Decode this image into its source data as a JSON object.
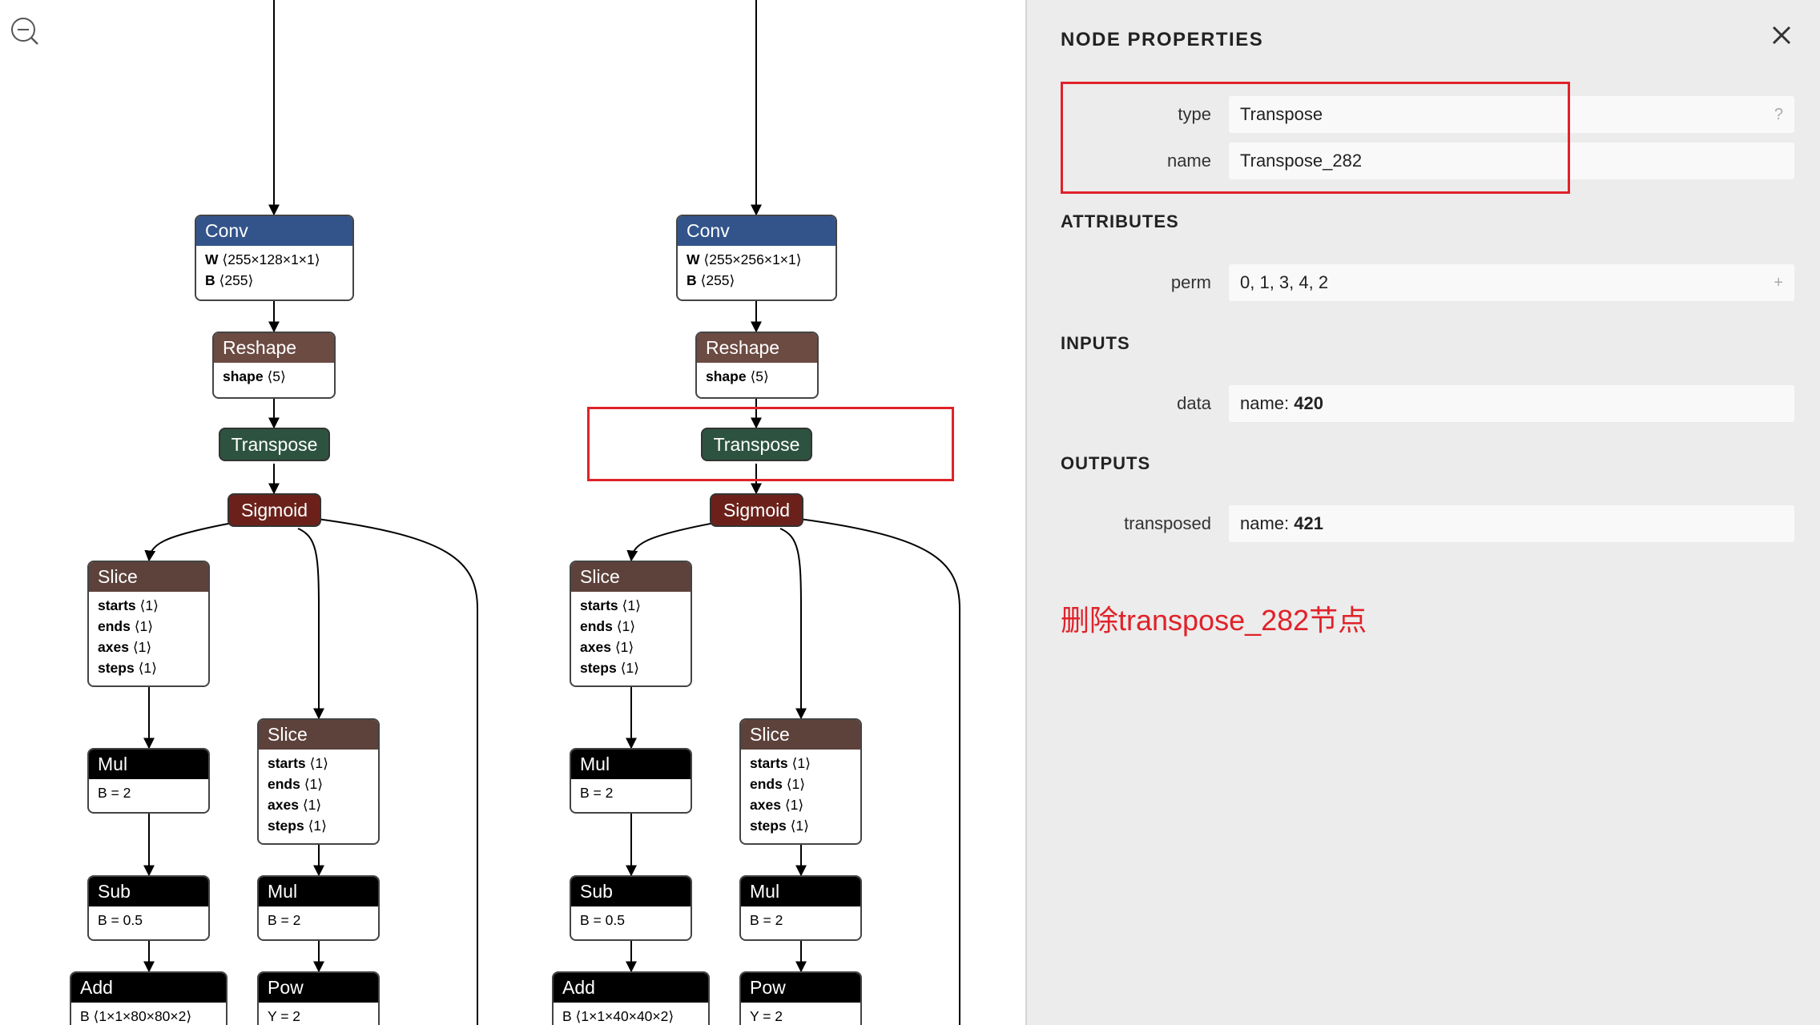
{
  "graph": {
    "left": {
      "conv": {
        "op": "Conv",
        "attrs": [
          {
            "k": "W",
            "v": "⟨255×128×1×1⟩"
          },
          {
            "k": "B",
            "v": "⟨255⟩"
          }
        ]
      },
      "reshape": {
        "op": "Reshape",
        "attrs": [
          {
            "k": "shape",
            "v": "⟨5⟩"
          }
        ]
      },
      "transpose": {
        "op": "Transpose"
      },
      "sigmoid": {
        "op": "Sigmoid"
      },
      "slice1": {
        "op": "Slice",
        "attrs": [
          {
            "k": "starts",
            "v": "⟨1⟩"
          },
          {
            "k": "ends",
            "v": "⟨1⟩"
          },
          {
            "k": "axes",
            "v": "⟨1⟩"
          },
          {
            "k": "steps",
            "v": "⟨1⟩"
          }
        ]
      },
      "slice2": {
        "op": "Slice",
        "attrs": [
          {
            "k": "starts",
            "v": "⟨1⟩"
          },
          {
            "k": "ends",
            "v": "⟨1⟩"
          },
          {
            "k": "axes",
            "v": "⟨1⟩"
          },
          {
            "k": "steps",
            "v": "⟨1⟩"
          }
        ]
      },
      "mul1": {
        "op": "Mul",
        "text": "B = 2"
      },
      "mul2": {
        "op": "Mul",
        "text": "B = 2"
      },
      "sub": {
        "op": "Sub",
        "text": "B = 0.5"
      },
      "add": {
        "op": "Add",
        "text": "B ⟨1×1×80×80×2⟩"
      },
      "pow": {
        "op": "Pow",
        "text": "Y = 2"
      }
    },
    "right": {
      "conv": {
        "op": "Conv",
        "attrs": [
          {
            "k": "W",
            "v": "⟨255×256×1×1⟩"
          },
          {
            "k": "B",
            "v": "⟨255⟩"
          }
        ]
      },
      "reshape": {
        "op": "Reshape",
        "attrs": [
          {
            "k": "shape",
            "v": "⟨5⟩"
          }
        ]
      },
      "transpose": {
        "op": "Transpose"
      },
      "sigmoid": {
        "op": "Sigmoid"
      },
      "slice1": {
        "op": "Slice",
        "attrs": [
          {
            "k": "starts",
            "v": "⟨1⟩"
          },
          {
            "k": "ends",
            "v": "⟨1⟩"
          },
          {
            "k": "axes",
            "v": "⟨1⟩"
          },
          {
            "k": "steps",
            "v": "⟨1⟩"
          }
        ]
      },
      "slice2": {
        "op": "Slice",
        "attrs": [
          {
            "k": "starts",
            "v": "⟨1⟩"
          },
          {
            "k": "ends",
            "v": "⟨1⟩"
          },
          {
            "k": "axes",
            "v": "⟨1⟩"
          },
          {
            "k": "steps",
            "v": "⟨1⟩"
          }
        ]
      },
      "mul1": {
        "op": "Mul",
        "text": "B = 2"
      },
      "mul2": {
        "op": "Mul",
        "text": "B = 2"
      },
      "sub": {
        "op": "Sub",
        "text": "B = 0.5"
      },
      "add": {
        "op": "Add",
        "text": "B ⟨1×1×40×40×2⟩"
      },
      "pow": {
        "op": "Pow",
        "text": "Y = 2"
      }
    }
  },
  "colors": {
    "conv": "#33548a",
    "reshape": "#6c4b43",
    "slice": "#5d423b",
    "black": "#000000",
    "transpose": "#2d5340",
    "sigmoid": "#6b211a",
    "highlight": "#e0222a",
    "sidebar_bg": "#ececec"
  },
  "icons": {
    "zoom": "zoom-out-icon",
    "close": "close-icon"
  },
  "sidebar": {
    "title": "NODE PROPERTIES",
    "properties": [
      {
        "label": "type",
        "value": "Transpose",
        "tail": "?"
      },
      {
        "label": "name",
        "value": "Transpose_282"
      }
    ],
    "attributes_title": "ATTRIBUTES",
    "attributes": [
      {
        "label": "perm",
        "value": "0, 1, 3, 4, 2",
        "tail": "+"
      }
    ],
    "inputs_title": "INPUTS",
    "inputs": [
      {
        "label": "data",
        "prefix": "name: ",
        "value": "420"
      }
    ],
    "outputs_title": "OUTPUTS",
    "outputs": [
      {
        "label": "transposed",
        "prefix": "name: ",
        "value": "421"
      }
    ],
    "note": "删除transpose_282节点"
  }
}
